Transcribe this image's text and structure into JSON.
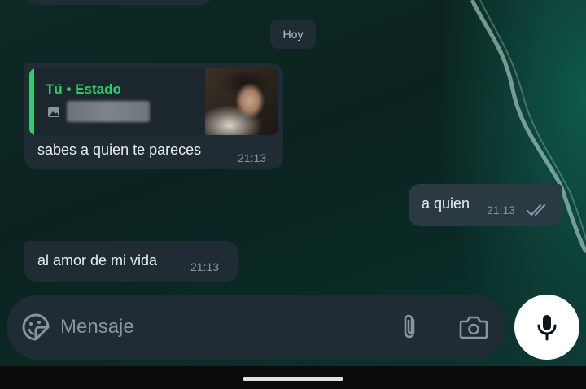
{
  "chat": {
    "day_chip": "Hoy",
    "messages": [
      {
        "direction": "in",
        "quote": {
          "author": "Tú",
          "separator": "•",
          "label": "Estado",
          "media_icon": "image-icon"
        },
        "text": "sabes a quien te pareces",
        "time": "21:13"
      },
      {
        "direction": "out",
        "text": "a quien",
        "time": "21:13",
        "status_icon": "double-check-icon"
      },
      {
        "direction": "in",
        "text": "al amor de mi vida",
        "time": "21:13"
      }
    ]
  },
  "composer": {
    "placeholder": "Mensaje",
    "emoji_icon": "sticker-icon",
    "attach_icon": "paperclip-icon",
    "camera_icon": "camera-icon",
    "mic_icon": "microphone-icon"
  },
  "colors": {
    "accent": "#25d366",
    "bubble_in": "#202c33",
    "bubble_out": "#2a3942",
    "meta_text": "#8696a0"
  }
}
